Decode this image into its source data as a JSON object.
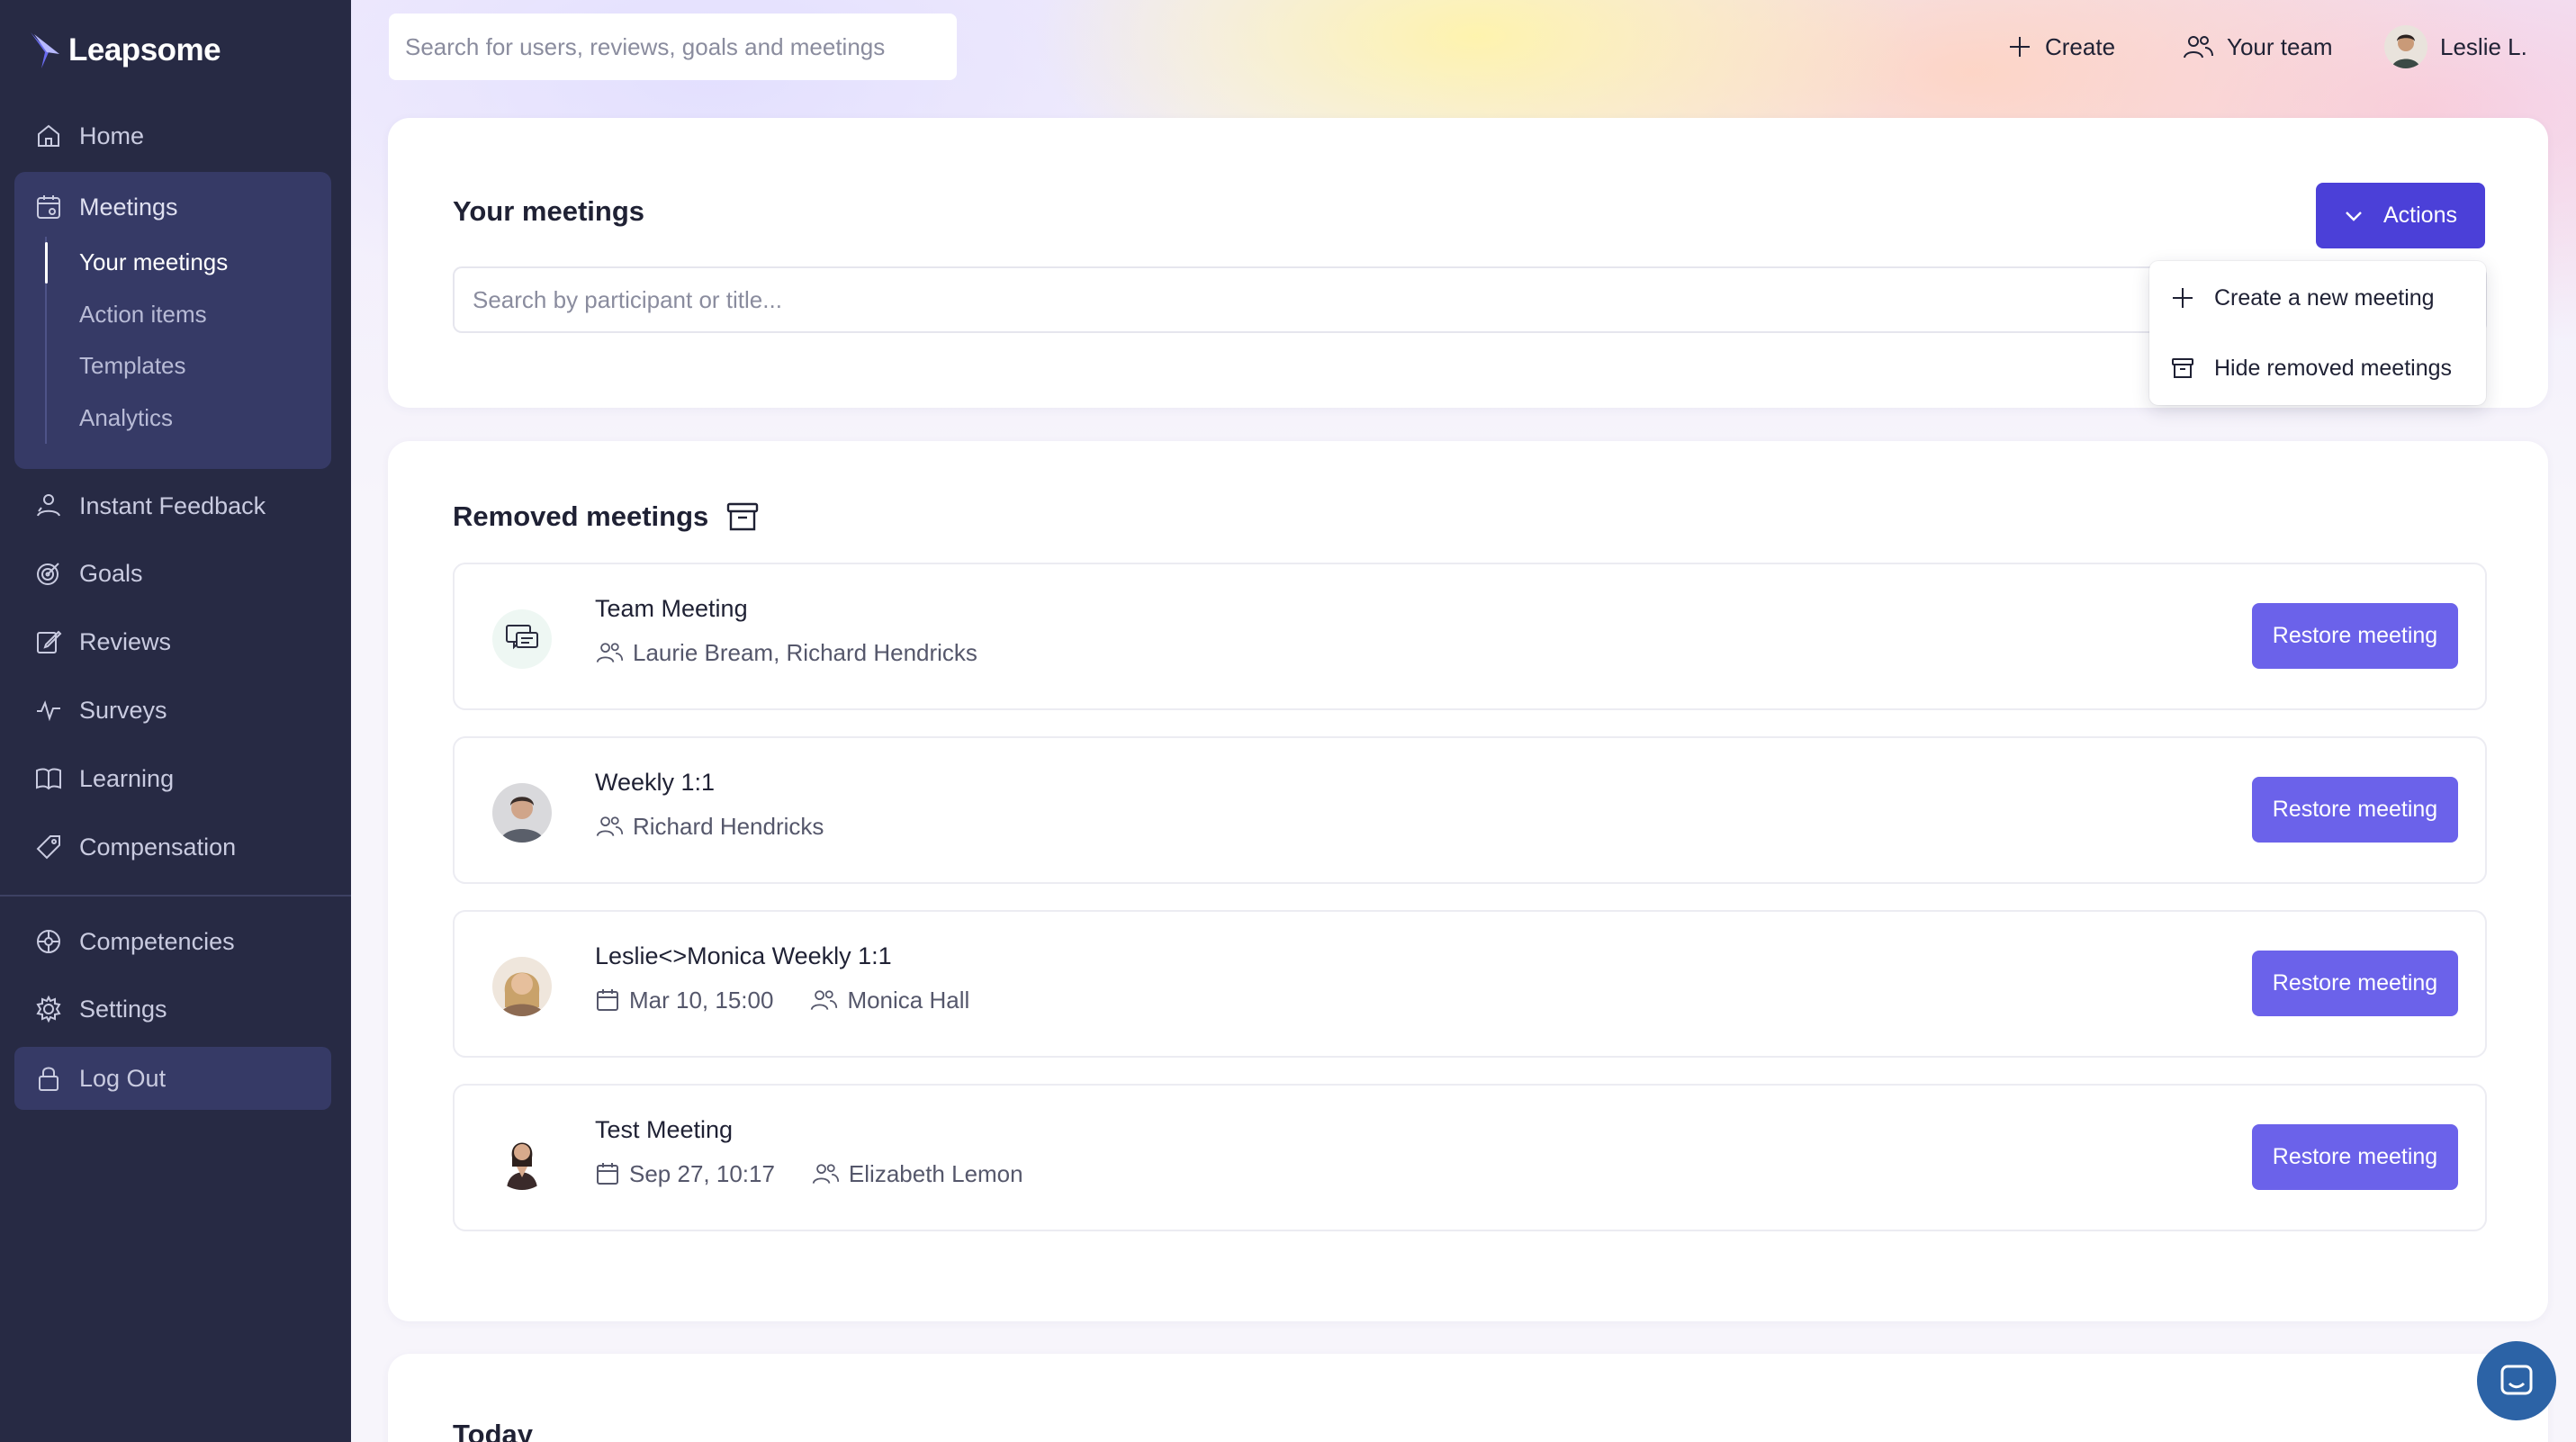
{
  "brand": {
    "name": "Leapsome"
  },
  "sidebar": {
    "items": [
      {
        "label": "Home",
        "icon": "home-icon"
      },
      {
        "label": "Meetings",
        "icon": "meetings-icon"
      },
      {
        "label": "Instant Feedback",
        "icon": "feedback-icon"
      },
      {
        "label": "Goals",
        "icon": "goals-icon"
      },
      {
        "label": "Reviews",
        "icon": "reviews-icon"
      },
      {
        "label": "Surveys",
        "icon": "surveys-icon"
      },
      {
        "label": "Learning",
        "icon": "learning-icon"
      },
      {
        "label": "Compensation",
        "icon": "compensation-icon"
      },
      {
        "label": "Competencies",
        "icon": "competencies-icon"
      },
      {
        "label": "Settings",
        "icon": "settings-icon"
      },
      {
        "label": "Log Out",
        "icon": "lock-icon"
      }
    ],
    "meetings_sub": [
      "Your meetings",
      "Action items",
      "Templates",
      "Analytics"
    ]
  },
  "topbar": {
    "search_placeholder": "Search for users, reviews, goals and meetings",
    "create_label": "Create",
    "team_label": "Your team",
    "user_label": "Leslie L."
  },
  "your_meetings": {
    "title": "Your meetings",
    "search_placeholder": "Search by participant or title...",
    "actions_label": "Actions",
    "menu": [
      {
        "label": "Create a new meeting",
        "icon": "plus-icon"
      },
      {
        "label": "Hide removed meetings",
        "icon": "archive-icon"
      }
    ]
  },
  "removed_meetings": {
    "title": "Removed meetings",
    "restore_label": "Restore meeting",
    "rows": [
      {
        "title": "Team Meeting",
        "date": "",
        "participants": "Laurie Bream, Richard Hendricks",
        "avatar": "team-chat-icon"
      },
      {
        "title": "Weekly 1:1",
        "date": "",
        "participants": "Richard Hendricks",
        "avatar": "man-avatar"
      },
      {
        "title": "Leslie<>Monica Weekly 1:1",
        "date": "Mar 10, 15:00",
        "participants": "Monica Hall",
        "avatar": "blonde-woman-avatar"
      },
      {
        "title": "Test Meeting",
        "date": "Sep 27, 10:17",
        "participants": "Elizabeth Lemon",
        "avatar": "dark-hair-woman-avatar"
      }
    ]
  },
  "today": {
    "title": "Today"
  },
  "colors": {
    "sidebar_bg": "#272a44",
    "sidebar_active": "#363a66",
    "primary": "#4b40d8",
    "restore": "#6b62ea",
    "chat": "#2c63a6"
  }
}
